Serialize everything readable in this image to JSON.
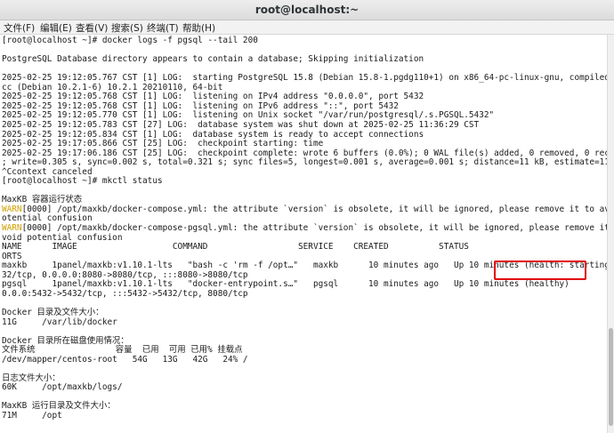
{
  "window": {
    "title": "root@localhost:~"
  },
  "menu": [
    {
      "label": "文件(F)",
      "key": "file"
    },
    {
      "label": "编辑(E)",
      "key": "edit"
    },
    {
      "label": "查看(V)",
      "key": "view"
    },
    {
      "label": "搜索(S)",
      "key": "search"
    },
    {
      "label": "终端(T)",
      "key": "terminal"
    },
    {
      "label": "帮助(H)",
      "key": "help"
    }
  ],
  "terminal": {
    "lines": [
      "[root@localhost ~]# docker logs -f pgsql --tail 200",
      "",
      "PostgreSQL Database directory appears to contain a database; Skipping initialization",
      "",
      "2025-02-25 19:12:05.767 CST [1] LOG:  starting PostgreSQL 15.8 (Debian 15.8-1.pgdg110+1) on x86_64-pc-linux-gnu, compiled by g",
      "cc (Debian 10.2.1-6) 10.2.1 20210110, 64-bit",
      "2025-02-25 19:12:05.768 CST [1] LOG:  listening on IPv4 address \"0.0.0.0\", port 5432",
      "2025-02-25 19:12:05.768 CST [1] LOG:  listening on IPv6 address \"::\", port 5432",
      "2025-02-25 19:12:05.770 CST [1] LOG:  listening on Unix socket \"/var/run/postgresql/.s.PGSQL.5432\"",
      "2025-02-25 19:12:05.783 CST [27] LOG:  database system was shut down at 2025-02-25 11:36:29 CST",
      "2025-02-25 19:12:05.834 CST [1] LOG:  database system is ready to accept connections",
      "2025-02-25 19:17:05.866 CST [25] LOG:  checkpoint starting: time",
      "2025-02-25 19:17:06.186 CST [25] LOG:  checkpoint complete: wrote 6 buffers (0.0%); 0 WAL file(s) added, 0 removed, 0 recycled",
      "; write=0.305 s, sync=0.002 s, total=0.321 s; sync files=5, longest=0.001 s, average=0.001 s; distance=11 kB, estimate=11 kB",
      "^Ccontext canceled",
      "[root@localhost ~]# mkctl status",
      "",
      "MaxKB 容器运行状态",
      "WARN[0000] /opt/maxkb/docker-compose.yml: the attribute `version` is obsolete, it will be ignored, please remove it to avoid p",
      "otential confusion",
      "WARN[0000] /opt/maxkb/docker-compose-pgsql.yml: the attribute `version` is obsolete, it will be ignored, please remove it to a",
      "void potential confusion",
      "NAME      IMAGE                   COMMAND                  SERVICE    CREATED          STATUS                                P",
      "ORTS",
      "maxkb     1panel/maxkb:v1.10.1-lts   \"bash -c 'rm -f /opt…\"   maxkb      10 minutes ago   Up 10 minutes (health: starting)   54",
      "32/tcp, 0.0.0.0:8080->8080/tcp, :::8080->8080/tcp",
      "pgsql     1panel/maxkb:v1.10.1-lts   \"docker-entrypoint.s…\"   pgsql      10 minutes ago   Up 10 minutes (healthy)            0.",
      "0.0.0:5432->5432/tcp, :::5432->5432/tcp, 8080/tcp",
      "",
      "Docker 目录及文件大小：",
      "11G     /var/lib/docker",
      "",
      "Docker 目录所在磁盘使用情况：",
      "文件系统                容量  已用  可用 已用% 挂载点",
      "/dev/mapper/centos-root   54G   13G   42G   24% /",
      "",
      "日志文件大小：",
      "60K     /opt/maxkb/logs/",
      "",
      "MaxKB 运行目录及文件大小：",
      "71M     /opt"
    ],
    "warn_prefix": "WARN"
  },
  "annotation": {
    "color": "#e00000"
  }
}
